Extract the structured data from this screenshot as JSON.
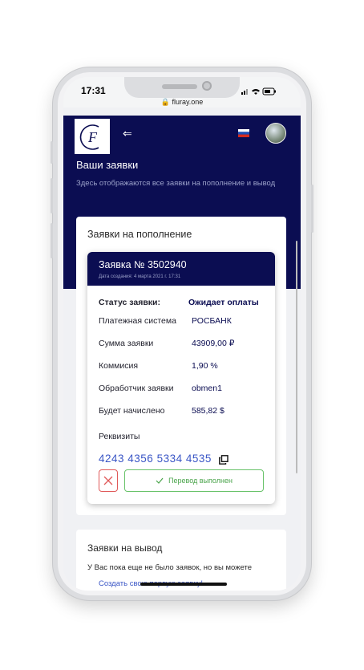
{
  "status_bar": {
    "time": "17:31"
  },
  "browser": {
    "url": "fluray.one"
  },
  "header": {
    "logo_letter": "F",
    "menu_symbol": "⇐"
  },
  "page": {
    "title": "Ваши заявки",
    "subtitle": "Здесь отображаются все заявки на пополнение и вывод"
  },
  "deposits": {
    "title": "Заявки на пополнение",
    "order": {
      "number": "Заявка № 3502940",
      "created": "Дата создания: 4 марта 2021 г. 17:31",
      "status_label": "Статус заявки:",
      "status_value": "Ожидает оплаты",
      "rows": [
        {
          "label": "Платежная система",
          "value": "РОСБАНК"
        },
        {
          "label": "Сумма заявки",
          "value": "43909,00 ₽"
        },
        {
          "label": "Коммисия",
          "value": "1,90 %"
        },
        {
          "label": "Обработчик заявки",
          "value": "obmen1"
        },
        {
          "label": "Будет начислено",
          "value": "585,82 $"
        }
      ],
      "requisites_label": "Реквизиты",
      "requisites_value": "4243 4356 5334 4535",
      "done_button": "Перевод выполнен"
    }
  },
  "withdrawals": {
    "title": "Заявки на вывод",
    "empty_text": "У Вас пока еще не было заявок, но вы можете",
    "create_link": "Создать свою первую заявку!"
  },
  "colors": {
    "navy": "#0b0d52",
    "accent": "#3a56c6",
    "danger": "#e05a5a",
    "success": "#69c36a"
  }
}
